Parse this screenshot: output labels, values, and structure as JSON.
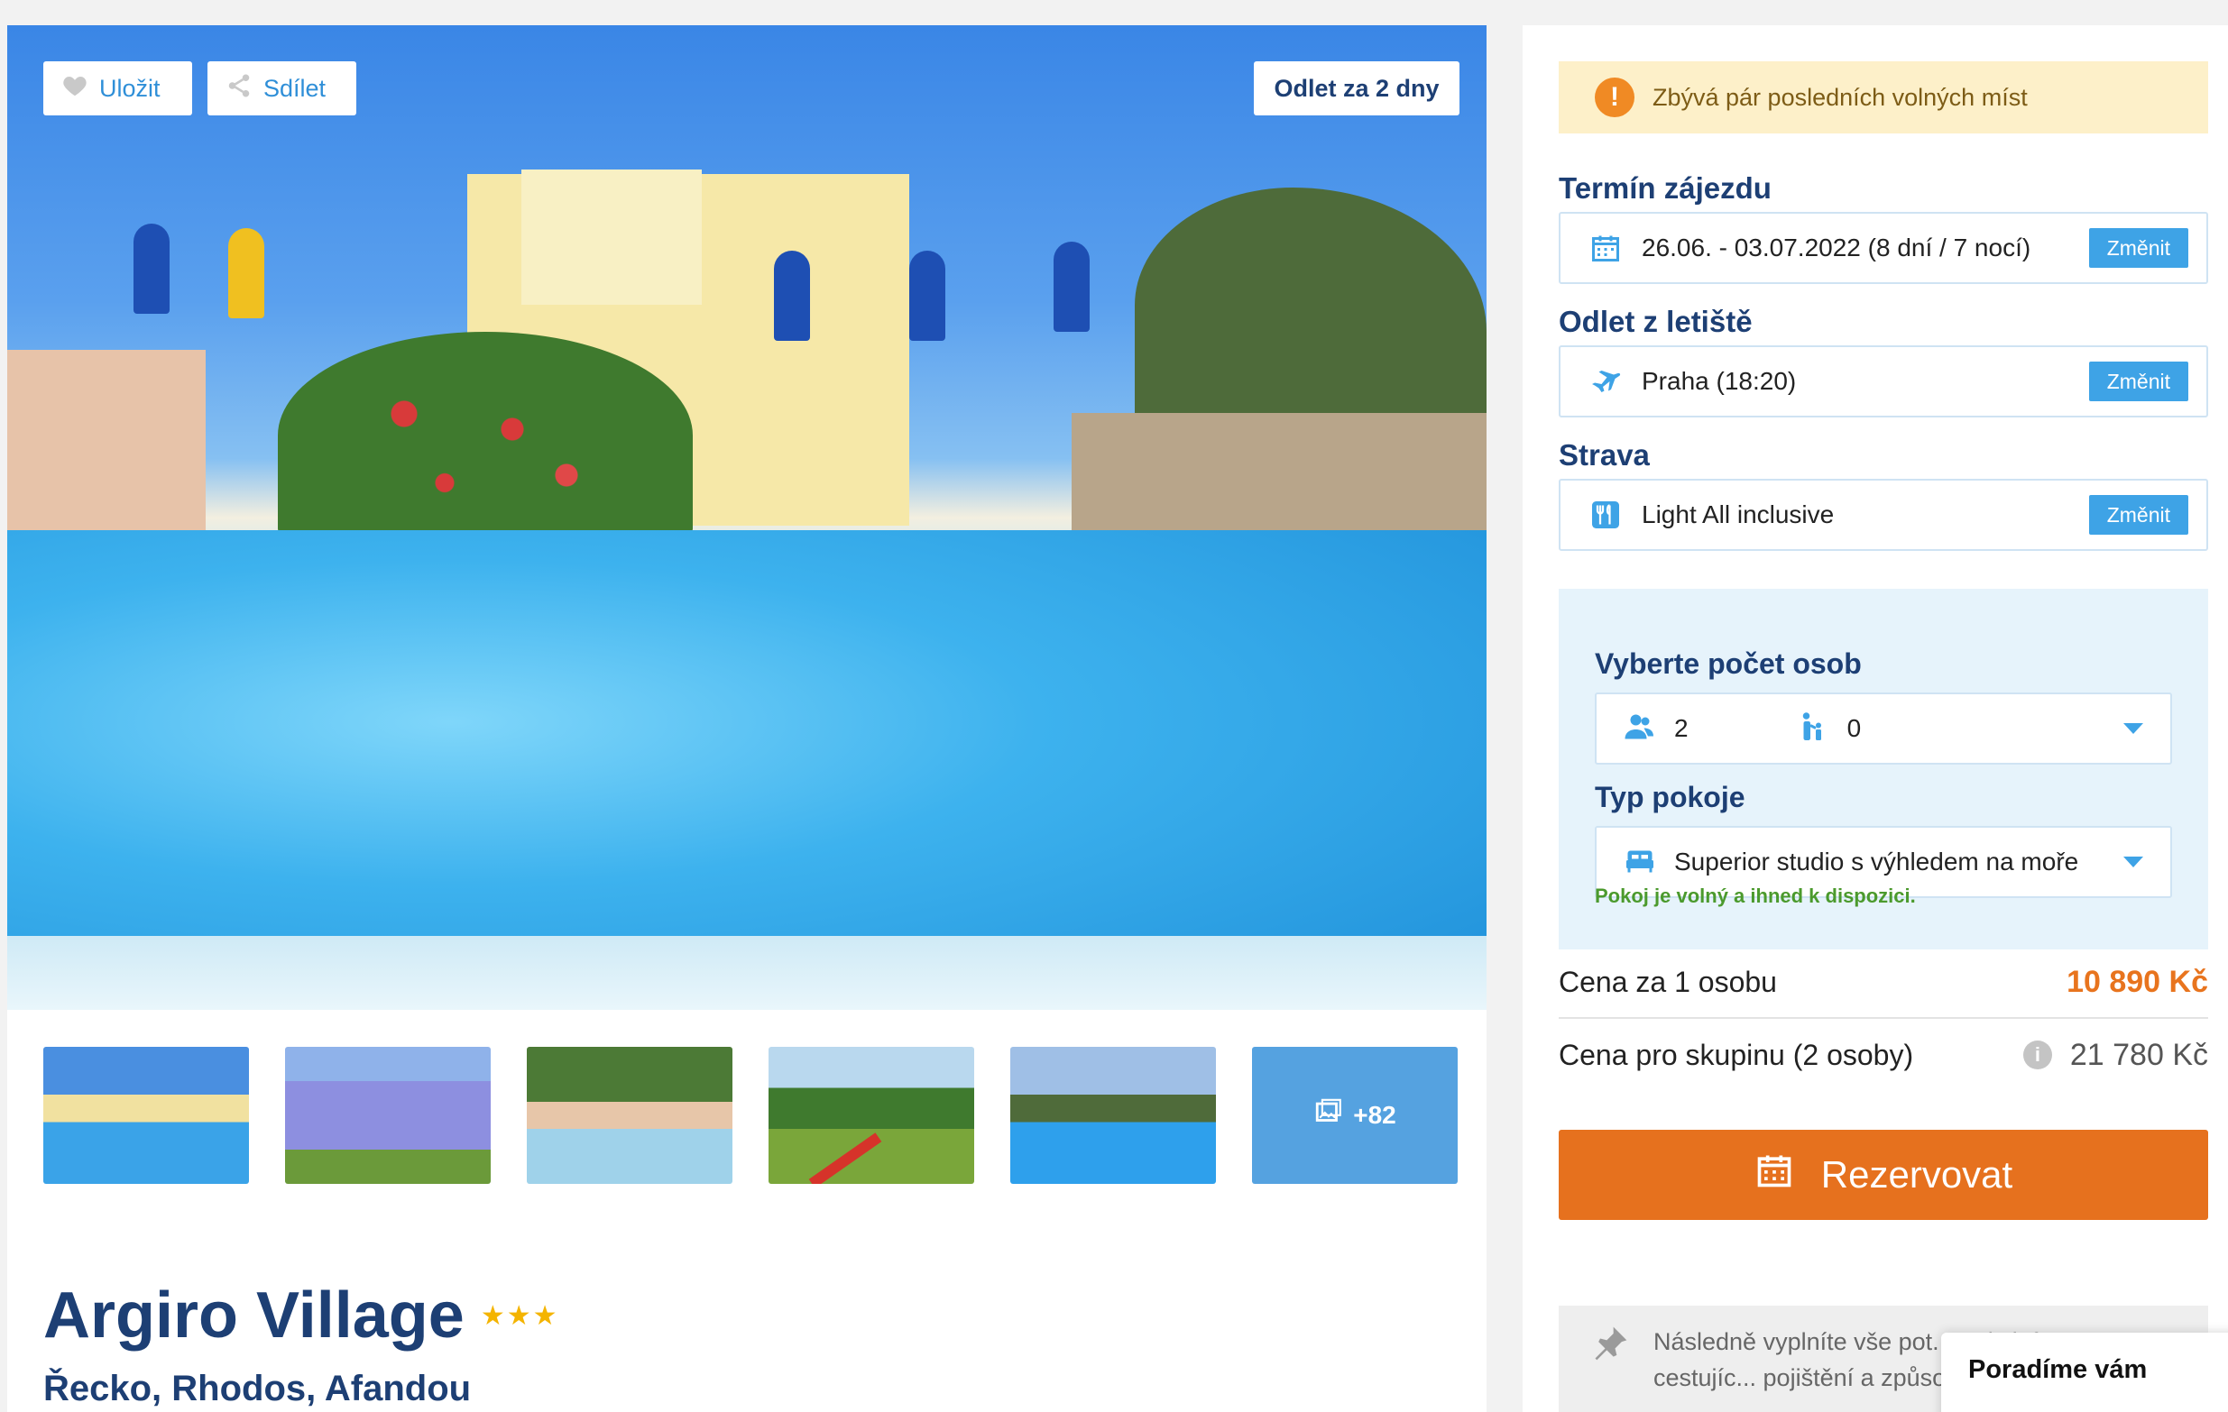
{
  "hero": {
    "save_label": "Uložit",
    "share_label": "Sdílet",
    "departure_badge": "Odlet za 2 dny"
  },
  "gallery": {
    "more_count": "+82",
    "thumbnails": [
      "pool",
      "building",
      "hot-tub",
      "playground",
      "pool-terrace"
    ]
  },
  "hotel": {
    "name": "Argiro Village",
    "stars": "★★★",
    "location": "Řecko, Rhodos, Afandou"
  },
  "booking": {
    "alert": "Zbývá pár posledních volných míst",
    "term": {
      "label": "Termín zájezdu",
      "value": "26.06. - 03.07.2022 (8 dní / 7 nocí)",
      "change": "Změnit"
    },
    "airport": {
      "label": "Odlet z letiště",
      "value": "Praha (18:20)",
      "change": "Změnit"
    },
    "board": {
      "label": "Strava",
      "value": "Light All inclusive",
      "change": "Změnit"
    },
    "persons": {
      "label": "Vyberte počet osob",
      "adults": "2",
      "children": "0"
    },
    "room": {
      "label": "Typ pokoje",
      "value": "Superior studio s výhledem na moře",
      "availability": "Pokoj je volný a ihned k dispozici."
    },
    "price_per_person": {
      "label": "Cena za 1 osobu",
      "value": "10 890 Kč"
    },
    "price_group": {
      "label": "Cena pro skupinu (2 osoby)",
      "value": "21 780 Kč"
    },
    "reserve_label": "Rezervovat",
    "note_text": "Následně vyplníte vše pot... tedy informace o cestujíc... pojištění a způsob platby",
    "chat_label": "Poradíme vám"
  },
  "colors": {
    "brand": "#1d3f74",
    "accent": "#3ea3e6",
    "cta": "#e6711e",
    "alert_bg": "#fdf0c9"
  }
}
